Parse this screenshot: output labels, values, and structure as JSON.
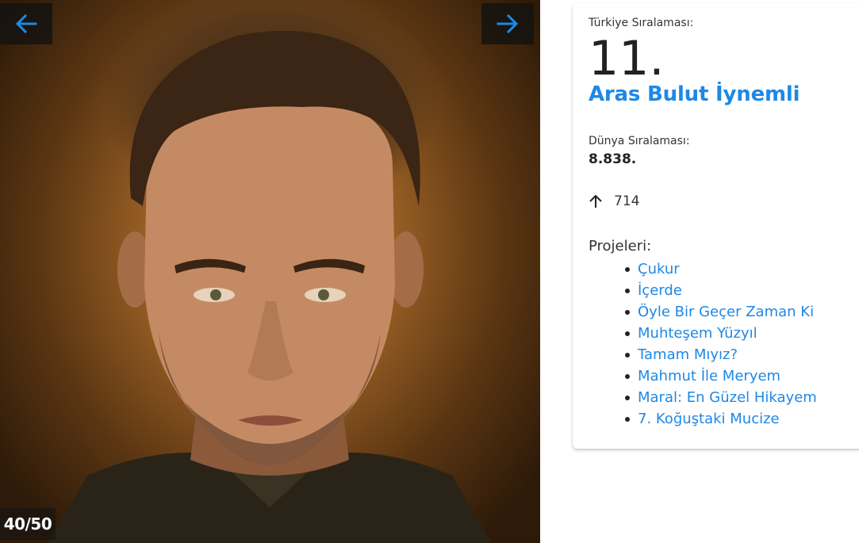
{
  "gallery": {
    "counter": "40/50",
    "prev_icon": "arrow-left-icon",
    "next_icon": "arrow-right-icon",
    "accent_color": "#1e88e5"
  },
  "actor": {
    "turkey_rank_label": "Türkiye Sıralaması:",
    "turkey_rank": "11.",
    "name": "Aras Bulut İynemli",
    "world_rank_label": "Dünya Sıralaması:",
    "world_rank": "8.838.",
    "trend_icon": "arrow-up-icon",
    "trend_value": "714",
    "projects_label": "Projeleri:",
    "projects": [
      "Çukur",
      "İçerde",
      "Öyle Bir Geçer Zaman Ki",
      "Muhteşem Yüzyıl",
      "Tamam Mıyız?",
      "Mahmut İle Meryem",
      "Maral: En Güzel Hikayem",
      "7. Koğuştaki Mucize"
    ]
  }
}
